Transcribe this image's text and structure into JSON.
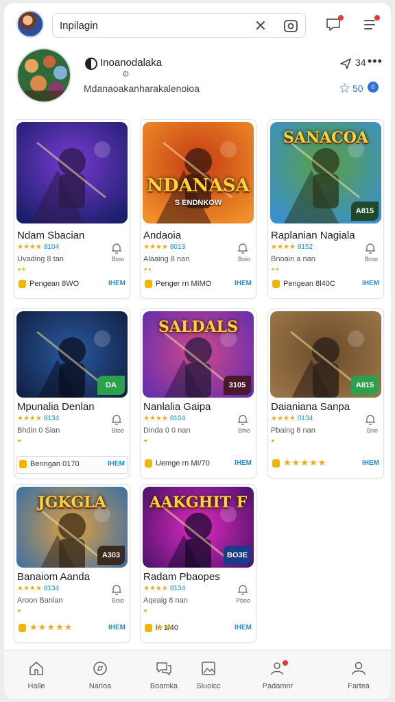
{
  "header": {
    "search_value": "Inpilagin",
    "icons": [
      "clear-icon",
      "camera-icon",
      "chat-icon",
      "menu-icon"
    ]
  },
  "profile": {
    "name": "Inoanodalaka",
    "subtitle": "Mdanaoakanharakalenoioa",
    "share_count": "34",
    "rating": "50",
    "rating_badge": "0"
  },
  "colors": {
    "accent": "#2e6fd8",
    "link": "#1b8fd8",
    "star": "#f0a81c",
    "notification": "#e53935"
  },
  "cards": [
    {
      "title": "Ndam Sbacian",
      "stars": "★★★★",
      "rating": "8104",
      "line2": "Uvading 8 tan",
      "bell_label": "Bioo",
      "mini": "★★",
      "footer_label": "Pengean 8WO",
      "footer_link": "IHEM",
      "footer_stars": "",
      "thumb_title": "",
      "thumb_sub": "",
      "badge": ""
    },
    {
      "title": "Andaoia",
      "stars": "★★★★",
      "rating": "8013",
      "line2": "Alaaing 8 nan",
      "bell_label": "Boio",
      "mini": "★★",
      "footer_label": "Penger rn MIMO",
      "footer_link": "IHEM",
      "footer_stars": "",
      "thumb_title": "NDANASA",
      "thumb_sub": "S ENDNKOW",
      "badge": ""
    },
    {
      "title": "Raplanian Nagiala",
      "stars": "★★★★",
      "rating": "8152",
      "line2": "Bnoain a nan",
      "bell_label": "Broo",
      "mini": "★★",
      "footer_label": "Pengean 8l40C",
      "footer_link": "IHEM",
      "footer_stars": "",
      "thumb_title": "SANACOA",
      "thumb_sub": "",
      "badge": "A815"
    },
    {
      "title": "Mpunalia Denlan",
      "stars": "★★★★",
      "rating": "8134",
      "line2": "Bhdin 0 Sian",
      "bell_label": "Btoo",
      "mini": "★",
      "footer_label": "Benngan 0170",
      "footer_link": "IHEM",
      "footer_stars": "",
      "thumb_title": "",
      "thumb_sub": "",
      "badge": "DA"
    },
    {
      "title": "Nanlalia Gaipa",
      "stars": "★★★★",
      "rating": "8104",
      "line2": "Dinda 0 0 nan",
      "bell_label": "Bhio",
      "mini": "★",
      "footer_label": "Uemge rn MI/70",
      "footer_link": "IHEM",
      "footer_stars": "",
      "thumb_title": "SALDALS",
      "thumb_sub": "",
      "badge": "3105"
    },
    {
      "title": "Daianiana Sanpa",
      "stars": "★★★★",
      "rating": "0134",
      "line2": "Pbaing 8 nan",
      "bell_label": "Brio",
      "mini": "★",
      "footer_label": "",
      "footer_link": "IHEM",
      "footer_stars": "★★★★★",
      "thumb_title": "",
      "thumb_sub": "",
      "badge": "A815"
    },
    {
      "title": "Banaiom Aanda",
      "stars": "★★★★",
      "rating": "8134",
      "line2": "Aroon Banlan",
      "bell_label": "Boio",
      "mini": "★",
      "footer_label": "",
      "footer_link": "IHEM",
      "footer_stars": "★★★★★",
      "thumb_title": "JGKGLA",
      "thumb_sub": "",
      "badge": "A303"
    },
    {
      "title": "Radam Pbaopes",
      "stars": "★★★★",
      "rating": "8134",
      "line2": "Aqeaig 8 nan",
      "bell_label": "Pboo",
      "mini": "★",
      "footer_label": "ln 1/40",
      "footer_link": "IHEM",
      "footer_stars": "★★",
      "thumb_title": "AAKGHIT F",
      "thumb_sub": "",
      "badge": "BO3E"
    }
  ],
  "nav": [
    {
      "label": "Halle",
      "icon": "home-icon"
    },
    {
      "label": "Narioa",
      "icon": "compass-icon"
    },
    {
      "label": "Boamka",
      "icon": "chat-bubbles-icon"
    },
    {
      "label": "Sluoicc",
      "icon": "image-icon"
    },
    {
      "label": "Padamnr",
      "icon": "users-icon"
    },
    {
      "label": "Fartea",
      "icon": "profile-icon"
    }
  ]
}
